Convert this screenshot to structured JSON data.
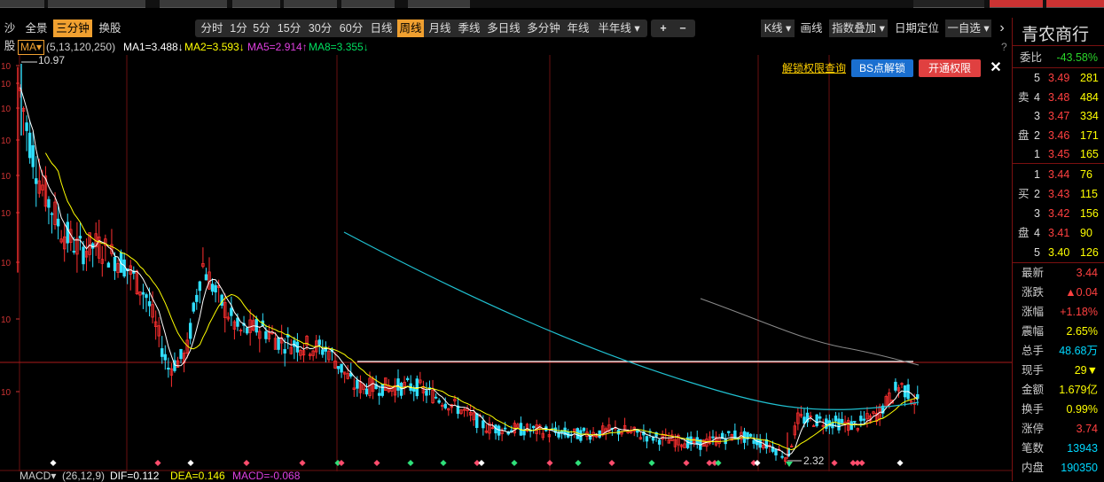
{
  "toolbar": {
    "left_tabs": [
      "沙股",
      "全景",
      "三分钟",
      "换股"
    ],
    "periods": [
      "分时",
      "1分",
      "5分",
      "15分",
      "30分",
      "60分",
      "日线",
      "周线",
      "月线",
      "季线",
      "多日线",
      "多分钟",
      "年线",
      "半年线 ▾"
    ],
    "active_period": "周线",
    "zoom_in": "+",
    "zoom_out": "−",
    "kline_label": "K线 ▾",
    "draw_label": "画线",
    "index_overlay": "指数叠加 ▾",
    "date_locate": "日期定位",
    "watchlist": "一自选 ▾",
    "more": "›"
  },
  "info_bar": {
    "ma_btn": "MA▾",
    "params": "(5,13,120,250)",
    "ma1": "MA1=3.488↓",
    "ma2": "MA2=3.593↓",
    "ma5": "MA5=2.914↑",
    "ma8": "MA8=3.355↓",
    "help": "?"
  },
  "overlay": {
    "unlock_link": "解锁权限查询",
    "bs_button": "BS点解锁",
    "open_button": "开通权限",
    "close": "✕"
  },
  "chart_labels": {
    "high": "10.97",
    "low": "2.32",
    "y_ticks": [
      "10",
      "10",
      "10",
      "10",
      "10",
      "10",
      "10",
      "10",
      "10"
    ]
  },
  "chart_data": {
    "type": "candlestick",
    "series": [
      {
        "name": "MA1",
        "value": 3.488
      },
      {
        "name": "MA2",
        "value": 3.593
      },
      {
        "name": "MA5",
        "value": 2.914
      },
      {
        "name": "MA8",
        "value": 3.355
      }
    ],
    "max_price": 10.97,
    "min_price": 2.32,
    "colors": {
      "up": "#ff3030",
      "down": "#30e0ff"
    }
  },
  "macd": {
    "label": "MACD▾",
    "params": "(26,12,9)",
    "dif": "DIF=0.112",
    "dea": "DEA=0.146",
    "macd": "MACD=-0.068"
  },
  "right_panel": {
    "title": "青农商行",
    "ratio_label": "委比",
    "ratio_val": "-43.58%",
    "sell_side": "卖盘",
    "buy_side": "买盘",
    "sell": [
      {
        "lvl": "5",
        "price": "3.49",
        "vol": "281"
      },
      {
        "lvl": "4",
        "price": "3.48",
        "vol": "484"
      },
      {
        "lvl": "3",
        "price": "3.47",
        "vol": "334"
      },
      {
        "lvl": "2",
        "price": "3.46",
        "vol": "171"
      },
      {
        "lvl": "1",
        "price": "3.45",
        "vol": "165"
      }
    ],
    "buy": [
      {
        "lvl": "1",
        "price": "3.44",
        "vol": "76"
      },
      {
        "lvl": "2",
        "price": "3.43",
        "vol": "115"
      },
      {
        "lvl": "3",
        "price": "3.42",
        "vol": "156"
      },
      {
        "lvl": "4",
        "price": "3.41",
        "vol": "90"
      },
      {
        "lvl": "5",
        "price": "3.40",
        "vol": "126"
      }
    ],
    "stats": [
      {
        "label": "最新",
        "val": "3.44",
        "cls": "up"
      },
      {
        "label": "涨跌",
        "val": "▲0.04",
        "cls": "up"
      },
      {
        "label": "涨幅",
        "val": "+1.18%",
        "cls": "up"
      },
      {
        "label": "震幅",
        "val": "2.65%",
        "cls": "yl"
      },
      {
        "label": "总手",
        "val": "48.68万",
        "cls": "cy"
      },
      {
        "label": "现手",
        "val": "29▼",
        "cls": "yl"
      },
      {
        "label": "金额",
        "val": "1.679亿",
        "cls": "yl"
      },
      {
        "label": "换手",
        "val": "0.99%",
        "cls": "yl"
      },
      {
        "label": "涨停",
        "val": "3.74",
        "cls": "up"
      },
      {
        "label": "笔数",
        "val": "13943",
        "cls": "cy"
      },
      {
        "label": "内盘",
        "val": "190350",
        "cls": "cy"
      }
    ]
  }
}
